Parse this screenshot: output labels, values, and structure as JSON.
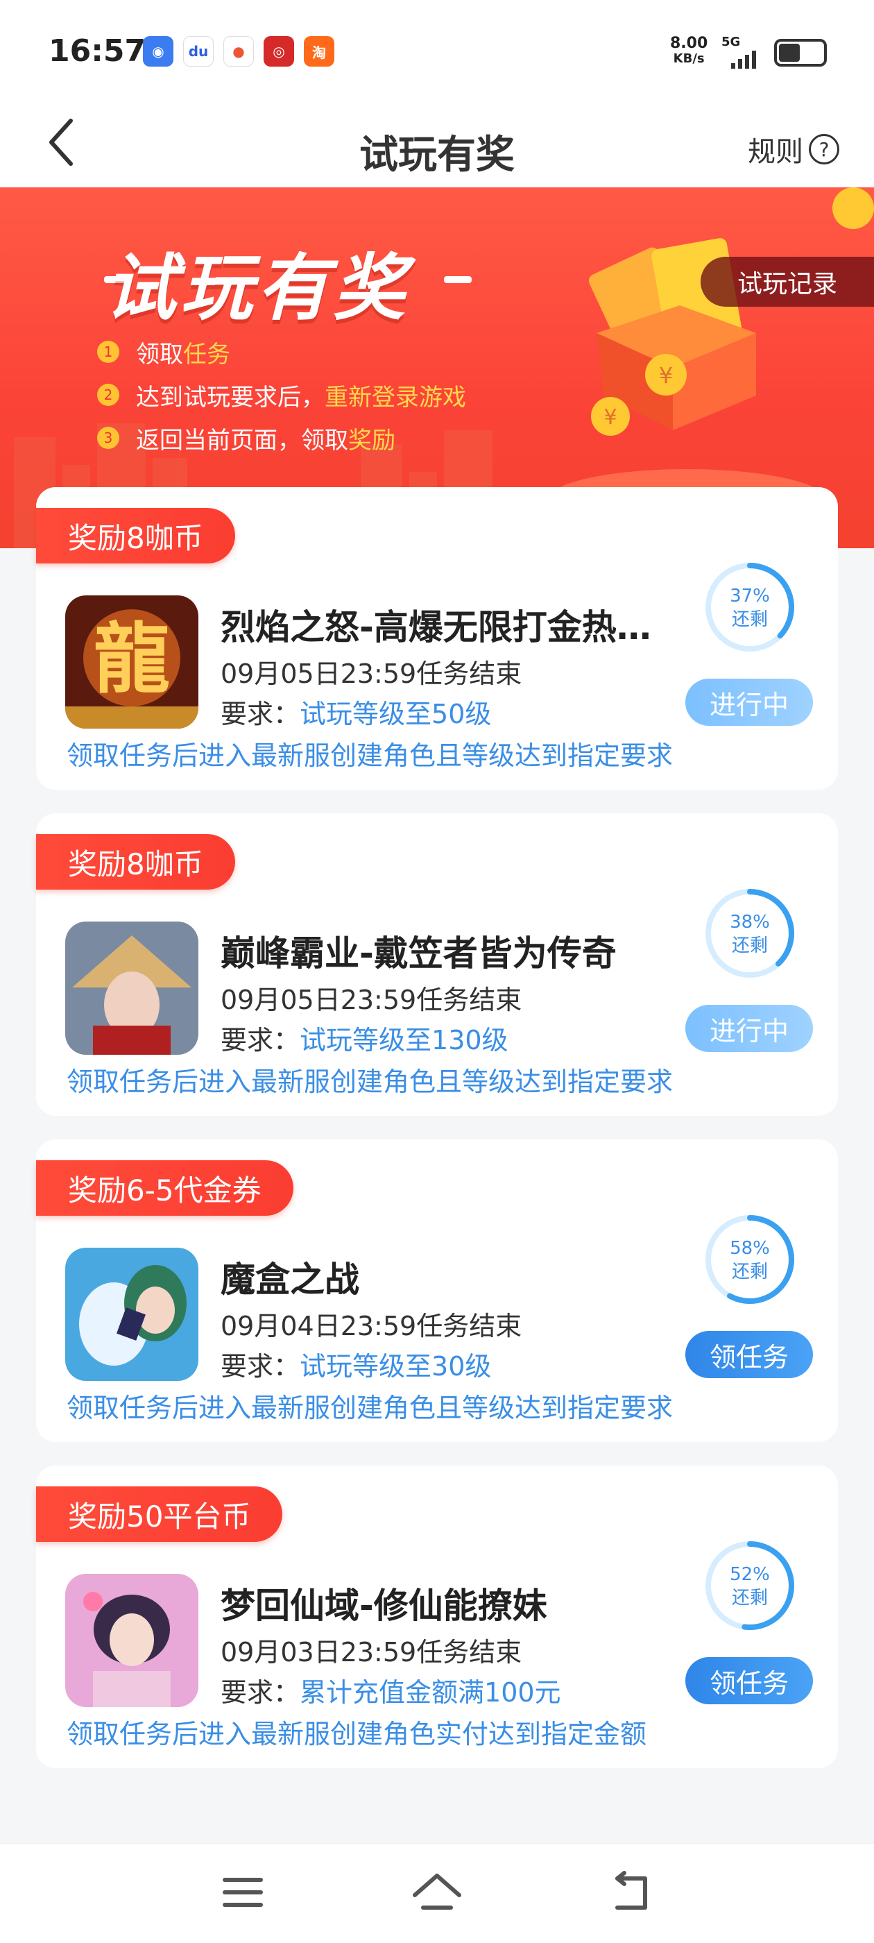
{
  "status_bar": {
    "time": "16:57",
    "speed_value": "8.00",
    "speed_unit": "KB/s",
    "network": "5G",
    "app_icons": [
      "browser-icon",
      "baidu-icon",
      "maps-icon",
      "bank-icon",
      "taobao-icon"
    ]
  },
  "nav": {
    "title": "试玩有奖",
    "rules_label": "规则",
    "help_symbol": "?"
  },
  "banner": {
    "title": "试玩有奖",
    "record_label": "试玩记录",
    "steps": [
      {
        "num": "1",
        "text": "领取",
        "highlight": "任务"
      },
      {
        "num": "2",
        "text": "达到试玩要求后，",
        "highlight": "重新登录游戏"
      },
      {
        "num": "3",
        "text": "返回当前页面，领取",
        "highlight": "奖励"
      }
    ]
  },
  "tasks": [
    {
      "reward": "奖励8咖币",
      "name": "烈焰之怒-高爆无限打金热…",
      "deadline": "09月05日23:59任务结束",
      "req_label": "要求：",
      "req_value": "试玩等级至50级",
      "note": "领取任务后进入最新服创建角色且等级达到指定要求",
      "remaining_pct": "37%",
      "remaining_label": "还剩",
      "remaining_fraction": 0.37,
      "button": "进行中",
      "button_style": "progress"
    },
    {
      "reward": "奖励8咖币",
      "name": "巅峰霸业-戴笠者皆为传奇",
      "deadline": "09月05日23:59任务结束",
      "req_label": "要求：",
      "req_value": "试玩等级至130级",
      "note": "领取任务后进入最新服创建角色且等级达到指定要求",
      "remaining_pct": "38%",
      "remaining_label": "还剩",
      "remaining_fraction": 0.38,
      "button": "进行中",
      "button_style": "progress"
    },
    {
      "reward": "奖励6-5代金券",
      "name": "魔盒之战",
      "deadline": "09月04日23:59任务结束",
      "req_label": "要求：",
      "req_value": "试玩等级至30级",
      "note": "领取任务后进入最新服创建角色且等级达到指定要求",
      "remaining_pct": "58%",
      "remaining_label": "还剩",
      "remaining_fraction": 0.58,
      "button": "领任务",
      "button_style": "take"
    },
    {
      "reward": "奖励50平台币",
      "name": "梦回仙域-修仙能撩妹",
      "deadline": "09月03日23:59任务结束",
      "req_label": "要求：",
      "req_value": "累计充值金额满100元",
      "note": "领取任务后进入最新服创建角色实付达到指定金额",
      "remaining_pct": "52%",
      "remaining_label": "还剩",
      "remaining_fraction": 0.52,
      "button": "领任务",
      "button_style": "take"
    }
  ],
  "colors": {
    "accent_red": "#fb4338",
    "accent_blue": "#3a8ee6",
    "highlight_yellow": "#ffd84d"
  }
}
